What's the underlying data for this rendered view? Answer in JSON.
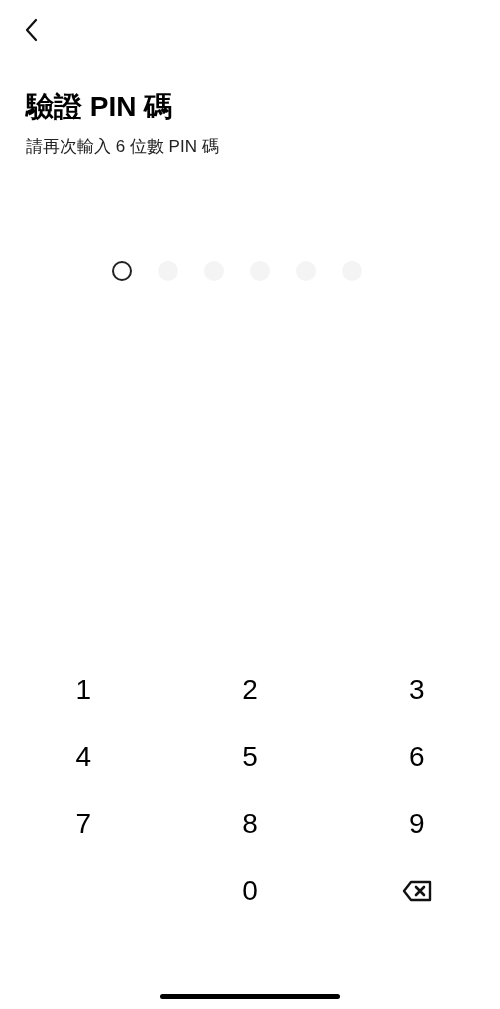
{
  "header": {
    "title": "驗證 PIN 碼",
    "subtitle": "請再次輸入 6 位數 PIN 碼"
  },
  "pin_dots": [
    {
      "selected": true
    },
    {
      "selected": false
    },
    {
      "selected": false
    },
    {
      "selected": false
    },
    {
      "selected": false
    },
    {
      "selected": false
    }
  ],
  "keypad": [
    {
      "kind": "digit",
      "label": "1"
    },
    {
      "kind": "digit",
      "label": "2"
    },
    {
      "kind": "digit",
      "label": "3"
    },
    {
      "kind": "digit",
      "label": "4"
    },
    {
      "kind": "digit",
      "label": "5"
    },
    {
      "kind": "digit",
      "label": "6"
    },
    {
      "kind": "digit",
      "label": "7"
    },
    {
      "kind": "digit",
      "label": "8"
    },
    {
      "kind": "digit",
      "label": "9"
    },
    {
      "kind": "blank"
    },
    {
      "kind": "digit",
      "label": "0"
    },
    {
      "kind": "backspace"
    }
  ]
}
